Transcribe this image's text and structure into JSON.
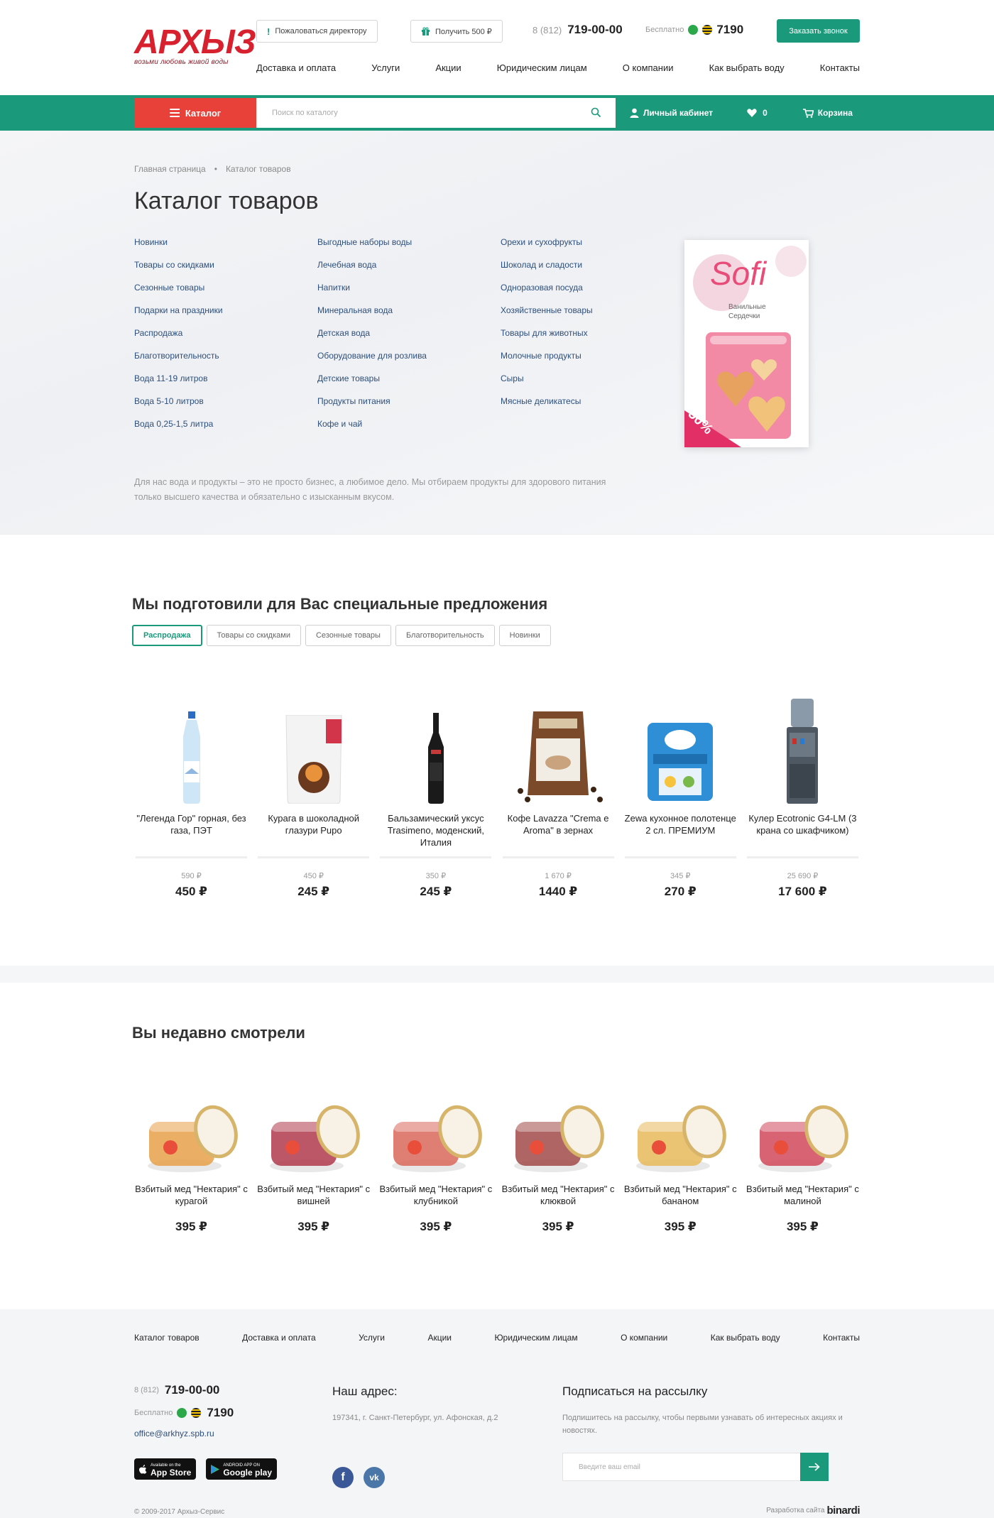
{
  "header": {
    "logo": "АРХЫЗ",
    "slogan": "возьми любовь живой воды",
    "complain_btn": "Пожаловаться директору",
    "gift_btn": "Получить 500 ₽",
    "phone_code": "8 (812)",
    "phone_number": "719-00-00",
    "free_label": "Бесплатно",
    "short_number": "7190",
    "call_btn": "Заказать звонок",
    "nav": [
      "Доставка и оплата",
      "Услуги",
      "Акции",
      "Юридическим лицам",
      "О компании",
      "Как выбрать воду",
      "Контакты"
    ]
  },
  "bar": {
    "catalog_btn": "Каталог",
    "search_placeholder": "Поиск по каталогу",
    "account": "Личный кабинет",
    "favorites_count": "0",
    "cart": "Корзина"
  },
  "catalog": {
    "breadcrumbs": [
      "Главная страница",
      "•",
      "Каталог товаров"
    ],
    "title": "Каталог товаров",
    "col1": [
      "Новинки",
      "Товары со скидками",
      "Сезонные товары",
      "Подарки на праздники",
      "Распродажа",
      "Благотворительность",
      "Вода 11-19 литров",
      "Вода 5-10 литров",
      "Вода 0,25-1,5 литра"
    ],
    "col2": [
      "Выгодные наборы воды",
      "Лечебная вода",
      "Напитки",
      "Минеральная вода",
      "Детская вода",
      "Оборудование для розлива",
      "Детские товары",
      "Продукты питания",
      "Кофе и чай"
    ],
    "col3": [
      "Орехи и сухофрукты",
      "Шоколад и сладости",
      "Одноразовая посуда",
      "Хозяйственные товары",
      "Товары для животных",
      "Молочные продукты",
      "Сыры",
      "Мясные деликатесы"
    ],
    "promo_brand": "Sofi",
    "promo_sub": "Ванильные Сердечки",
    "promo_discount": "50%",
    "description": "Для нас вода и продукты – это не просто бизнес, а любимое дело. Мы отбираем продукты для здорового питания только высшего качества и обязательно с изысканным вкусом."
  },
  "offers": {
    "title": "Мы подготовили для Вас специальные предложения",
    "tabs": [
      "Распродажа",
      "Товары со скидками",
      "Сезонные товары",
      "Благотворительность",
      "Новинки"
    ],
    "products": [
      {
        "name": "\"Легенда Гор\" горная, без газа, ПЭТ",
        "old": "590 ₽",
        "price": "450 ₽"
      },
      {
        "name": "Курага в шоколадной глазури Pupo",
        "old": "450 ₽",
        "price": "245 ₽"
      },
      {
        "name": "Бальзамический уксус Trasimeno, моденский, Италия",
        "old": "350 ₽",
        "price": "245 ₽"
      },
      {
        "name": "Кофе Lavazza \"Crema e Aroma\" в зернах",
        "old": "1 670 ₽",
        "price": "1440 ₽"
      },
      {
        "name": "Zewa кухонное полотенце 2 сл. ПРЕМИУМ",
        "old": "345 ₽",
        "price": "270 ₽"
      },
      {
        "name": "Кулер Ecotronic G4-LM (3 крана со шкафчиком)",
        "old": "25 690 ₽",
        "price": "17 600 ₽"
      }
    ]
  },
  "recent": {
    "title": "Вы недавно смотрели",
    "products": [
      {
        "name": "Взбитый мед \"Нектария\" с курагой",
        "price": "395 ₽",
        "color": "#e8a04a"
      },
      {
        "name": "Взбитый мед \"Нектария\" с вишней",
        "price": "395 ₽",
        "color": "#b03a4e"
      },
      {
        "name": "Взбитый мед \"Нектария\" с клубникой",
        "price": "395 ₽",
        "color": "#d9685a"
      },
      {
        "name": "Взбитый мед \"Нектария\" с клюквой",
        "price": "395 ₽",
        "color": "#a04a48"
      },
      {
        "name": "Взбитый мед \"Нектария\" с бананом",
        "price": "395 ₽",
        "color": "#e6b95a"
      },
      {
        "name": "Взбитый мед \"Нектария\" с малиной",
        "price": "395 ₽",
        "color": "#d0485a"
      }
    ]
  },
  "footer": {
    "nav": [
      "Каталог товаров",
      "Доставка и оплата",
      "Услуги",
      "Акции",
      "Юридическим лицам",
      "О компании",
      "Как выбрать воду",
      "Контакты"
    ],
    "phone_code": "8 (812)",
    "phone_number": "719-00-00",
    "free_label": "Бесплатно",
    "short_number": "7190",
    "email": "office@arkhyz.spb.ru",
    "appstore": "App Store",
    "appstore_small": "Available on the",
    "googleplay": "Google play",
    "googleplay_small": "ANDROID APP ON",
    "address_title": "Наш адрес:",
    "address": "197341, г. Санкт-Петербург, ул. Афонская, д.2",
    "sub_title": "Подписаться на рассылку",
    "sub_text": "Подпишитесь на рассылку, чтобы первыми узнавать об интересных акциях и новостях.",
    "sub_placeholder": "Введите ваш email",
    "copyright": "© 2009-2017 Архыз-Сервис",
    "dev_label": "Разработка сайта",
    "dev_name": "binardi"
  }
}
